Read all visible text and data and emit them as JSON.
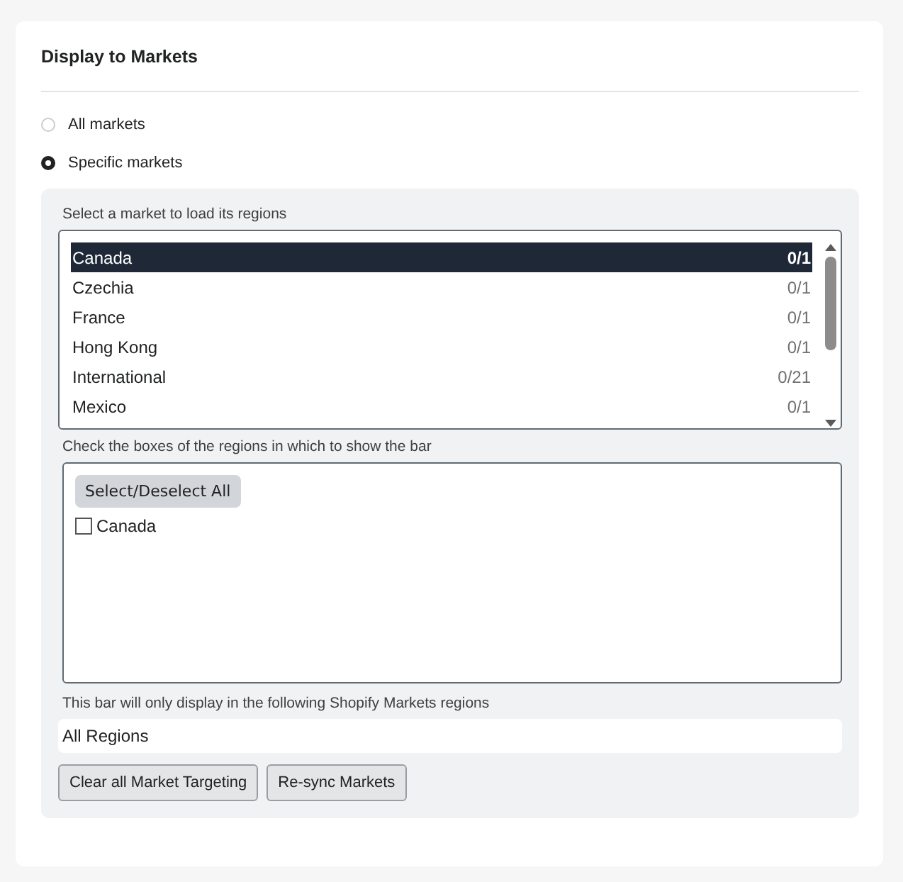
{
  "card": {
    "title": "Display to Markets"
  },
  "options": [
    {
      "label": "All markets",
      "selected": false
    },
    {
      "label": "Specific markets",
      "selected": true
    }
  ],
  "market_list": {
    "label": "Select a market to load its regions",
    "items": [
      {
        "name": "Canada",
        "count": "0/1",
        "selected": true
      },
      {
        "name": "Czechia",
        "count": "0/1",
        "selected": false
      },
      {
        "name": "France",
        "count": "0/1",
        "selected": false
      },
      {
        "name": "Hong Kong",
        "count": "0/1",
        "selected": false
      },
      {
        "name": "International",
        "count": "0/21",
        "selected": false
      },
      {
        "name": "Mexico",
        "count": "0/1",
        "selected": false
      }
    ]
  },
  "regions": {
    "label": "Check the boxes of the regions in which to show the bar",
    "select_all": "Select/Deselect All",
    "items": [
      {
        "name": "Canada",
        "checked": false
      }
    ]
  },
  "summary": {
    "label": "This bar will only display in the following Shopify Markets regions",
    "value": "All Regions"
  },
  "buttons": [
    "Clear all Market Targeting",
    "Re-sync Markets"
  ]
}
